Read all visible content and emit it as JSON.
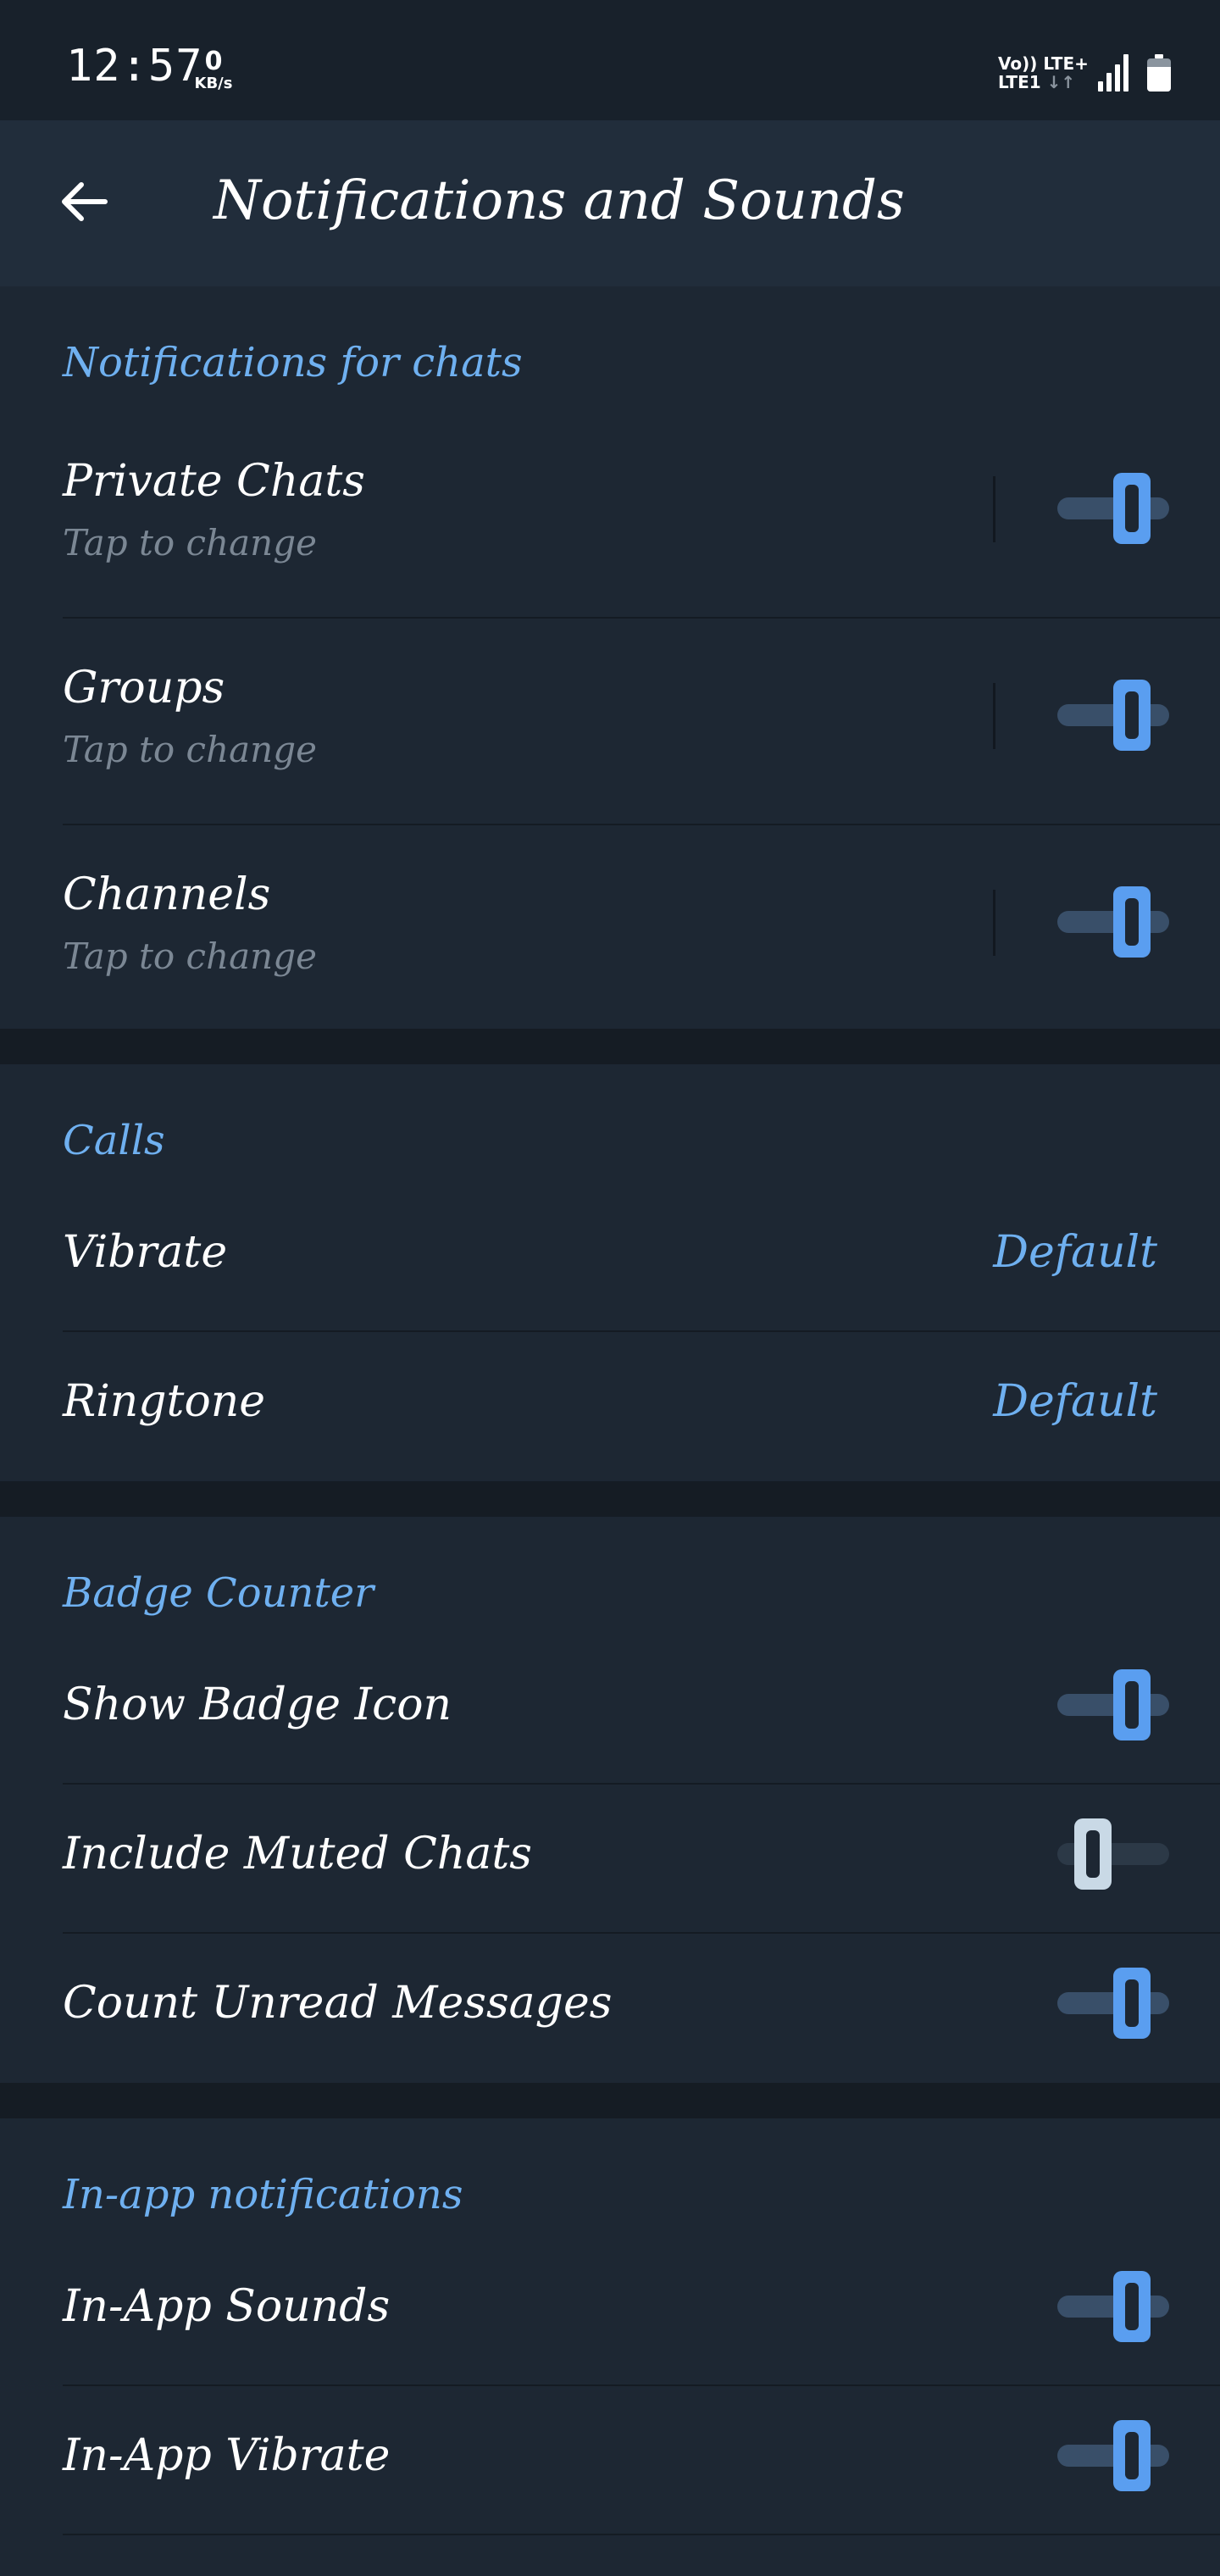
{
  "status_bar": {
    "time": "12:57",
    "data_speed": "0",
    "data_unit": "KB/s",
    "network_line1": "Vo)) LTE+",
    "network_line2": "LTE1",
    "network_arrows": "↓↑",
    "battery_level": 0.75
  },
  "header": {
    "title": "Notifications and Sounds"
  },
  "sections": {
    "chats": {
      "title": "Notifications for chats",
      "rows": [
        {
          "label": "Private Chats",
          "sub": "Tap to change",
          "enabled": true
        },
        {
          "label": "Groups",
          "sub": "Tap to change",
          "enabled": true
        },
        {
          "label": "Channels",
          "sub": "Tap to change",
          "enabled": true
        }
      ]
    },
    "calls": {
      "title": "Calls",
      "rows": [
        {
          "label": "Vibrate",
          "value": "Default"
        },
        {
          "label": "Ringtone",
          "value": "Default"
        }
      ]
    },
    "badge": {
      "title": "Badge Counter",
      "rows": [
        {
          "label": "Show Badge Icon",
          "enabled": true
        },
        {
          "label": "Include Muted Chats",
          "enabled": false
        },
        {
          "label": "Count Unread Messages",
          "enabled": true
        }
      ]
    },
    "inapp": {
      "title": "In-app notifications",
      "rows": [
        {
          "label": "In-App Sounds",
          "enabled": true
        },
        {
          "label": "In-App Vibrate",
          "enabled": true
        }
      ]
    }
  },
  "colors": {
    "accent": "#6fb0f0",
    "toggle_on": "#5a9ef0",
    "background": "#1d2733",
    "header": "#212d3b"
  }
}
